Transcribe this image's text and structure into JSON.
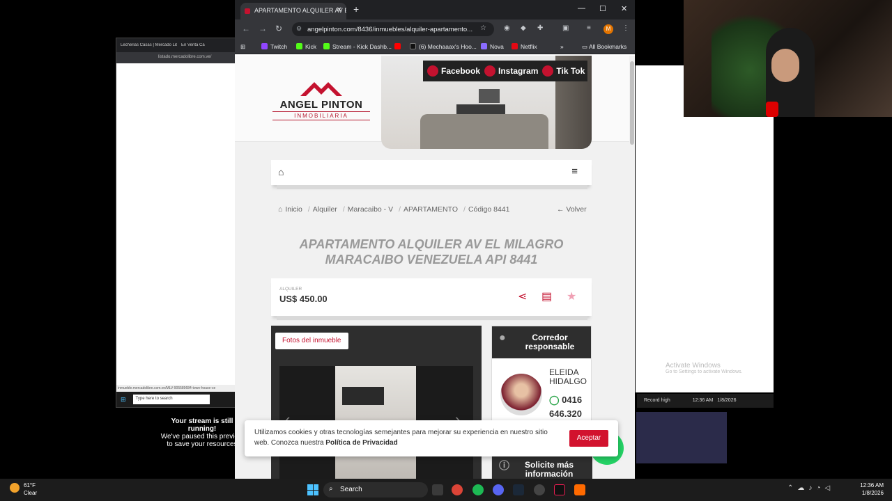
{
  "background": {
    "bg_tabs": [
      "Lecherias Casas | Mercado Libre",
      "En Venta Ca"
    ],
    "bg_url": "listado.mercadolibre.com.ve/",
    "bg_status_url": "inmueble.mercadolibre.com.ve/MLV-905589684-town-house-ce",
    "bg_search_placeholder": "Type here to search",
    "stream_paused_title": "Your stream is still running!",
    "stream_paused_body": "We've paused this preview to save your resources",
    "activate_title": "Activate Windows",
    "activate_sub": "Go to Settings to activate Windows.",
    "record_label": "Record high",
    "mini_time": "12:36 AM",
    "mini_date": "1/8/2026"
  },
  "browser": {
    "tab_title": "APARTAMENTO ALQUILER AV EL",
    "url": "angelpinton.com/8436/inmuebles/alquiler-apartamento...",
    "profile_initial": "M",
    "bookmarks": [
      {
        "label": "Twitch",
        "color": "#9146ff"
      },
      {
        "label": "Kick",
        "color": "#53fc18"
      },
      {
        "label": "Stream - Kick Dashb...",
        "color": "#53fc18"
      },
      {
        "label": "",
        "color": "#ff0000"
      },
      {
        "label": "(6) Mechaaax's Hoo...",
        "color": "#111111"
      },
      {
        "label": "Nova",
        "color": "#8a6cff"
      },
      {
        "label": "Netflix",
        "color": "#e50914"
      }
    ],
    "all_bookmarks": "All Bookmarks"
  },
  "site": {
    "logo_name": "ANGEL PINTON",
    "logo_sub": "INMOBILIARIA",
    "social": [
      "Facebook",
      "Instagram",
      "Tik Tok"
    ],
    "breadcrumb": [
      "Inicio",
      "Alquiler",
      "Maracaibo - V",
      "APARTAMENTO",
      "Código 8441"
    ],
    "back": "Volver",
    "title_line1": "APARTAMENTO ALQUILER AV EL MILAGRO",
    "title_line2": "MARACAIBO VENEZUELA API 8441",
    "price_label": "ALQUILER",
    "price": "US$ 450.00",
    "photos_button": "Fotos del inmueble",
    "agent_header": "Corredor responsable",
    "agent_name": "ELEIDA HIDALGO",
    "agent_phone_1": "0416",
    "agent_phone_2": "646.320",
    "info_header": "Solicite más información",
    "cookie_text": "Utilizamos cookies y otras tecnologías semejantes para mejorar su experiencia en nuestro sitio web. Conozca nuestra",
    "cookie_link": "Política de Privacidad",
    "accept": "Aceptar",
    "brand_red": "#c4122f"
  },
  "taskbar": {
    "temp": "61°F",
    "weather": "Clear",
    "search": "Search",
    "time": "12:36 AM",
    "date": "1/8/2026"
  }
}
